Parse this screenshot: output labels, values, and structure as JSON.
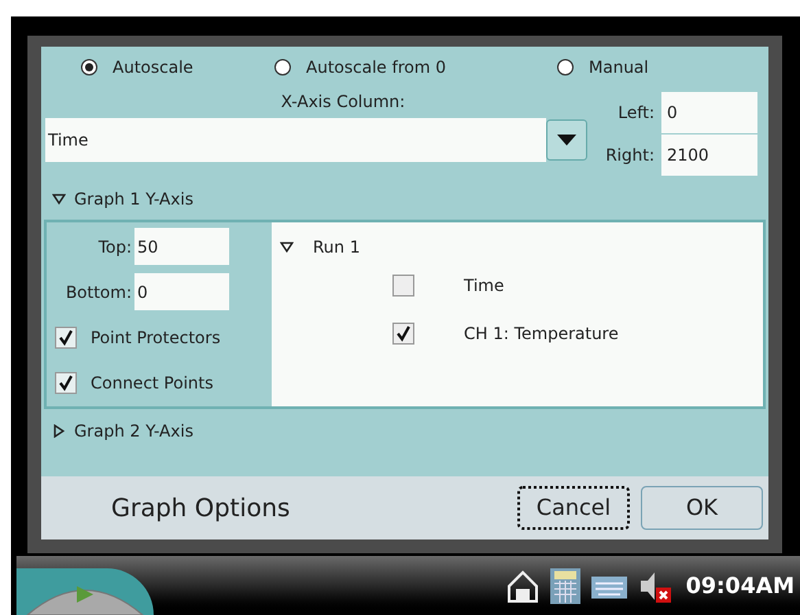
{
  "scale_modes": [
    {
      "label": "Autoscale",
      "selected": true
    },
    {
      "label": "Autoscale from 0",
      "selected": false
    },
    {
      "label": "Manual",
      "selected": false
    }
  ],
  "x_axis": {
    "label": "X-Axis Column:",
    "value": "Time"
  },
  "left": {
    "label": "Left:",
    "value": "0"
  },
  "right": {
    "label": "Right:",
    "value": "2100"
  },
  "graph_1": {
    "label": "Graph 1 Y-Axis",
    "expanded": true,
    "top": {
      "label": "Top:",
      "value": "50"
    },
    "bottom": {
      "label": "Bottom:",
      "value": "0"
    },
    "options": [
      {
        "label": "Point Protectors",
        "checked": true
      },
      {
        "label": "Connect Points",
        "checked": true
      }
    ],
    "runs": [
      {
        "label": "Run 1",
        "expanded": true,
        "columns": [
          {
            "label": "Time",
            "checked": false
          },
          {
            "label": "CH 1: Temperature",
            "checked": true
          }
        ]
      }
    ]
  },
  "graph_2": {
    "label": "Graph 2 Y-Axis",
    "expanded": false
  },
  "footer": {
    "title": "Graph Options",
    "buttons": [
      {
        "label": "Cancel",
        "focused": true
      },
      {
        "label": "OK",
        "focused": false
      }
    ]
  },
  "taskbar": {
    "time": "09:04AM"
  }
}
